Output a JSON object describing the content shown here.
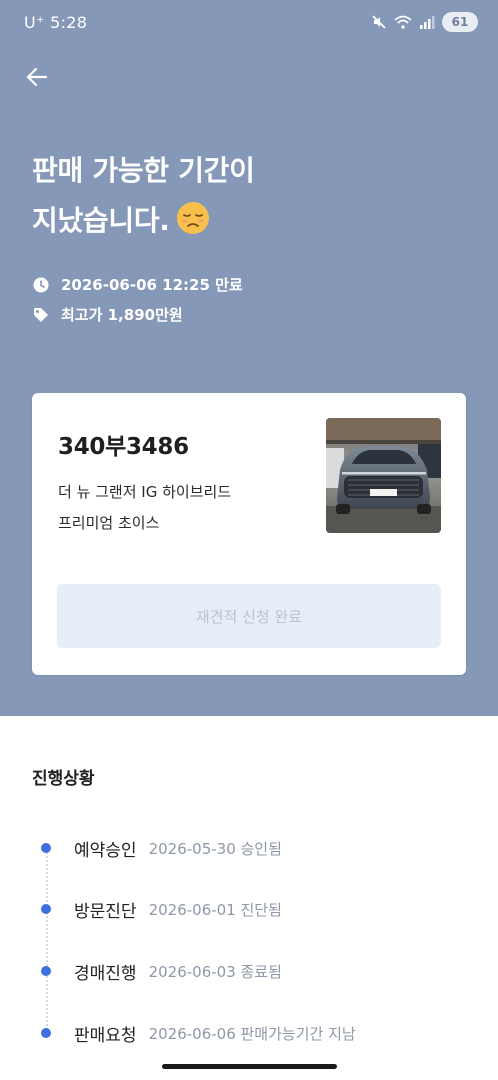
{
  "status_bar": {
    "carrier_time": "U⁺ 5:28",
    "battery": "61"
  },
  "header": {
    "title_line1": "판매 가능한 기간이",
    "title_line2": "지났습니다."
  },
  "meta": {
    "expiry": "2026-06-06 12:25 만료",
    "top_price": "최고가 1,890만원"
  },
  "car_card": {
    "plate": "340부3486",
    "model_line1": "더 뉴 그랜저 IG 하이브리드",
    "model_line2": "프리미엄 초이스",
    "button_label": "재견적 신청 완료"
  },
  "progress": {
    "title": "진행상황",
    "steps": [
      {
        "label": "예약승인",
        "detail": "2026-05-30 승인됨"
      },
      {
        "label": "방문진단",
        "detail": "2026-06-01 진단됨"
      },
      {
        "label": "경매진행",
        "detail": "2026-06-03 종료됨"
      },
      {
        "label": "판매요청",
        "detail": "2026-06-06 판매가능기간 지남"
      }
    ]
  },
  "colors": {
    "hero_background": "#8598b8",
    "timeline_dot": "#3d6fe0",
    "button_background": "#e8eef7"
  },
  "icons": [
    "back-arrow-icon",
    "mute-icon",
    "wifi-icon",
    "signal-icon",
    "clock-icon",
    "tag-icon",
    "sad-face-emoji"
  ]
}
